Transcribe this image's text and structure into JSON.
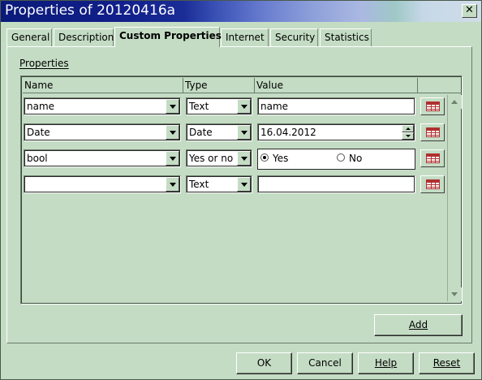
{
  "window": {
    "title": "Properties of 20120416a",
    "close_label": "✕"
  },
  "tabs": [
    {
      "label": "General"
    },
    {
      "label": "Description"
    },
    {
      "label": "Custom Properties",
      "active": true
    },
    {
      "label": "Internet"
    },
    {
      "label": "Security"
    },
    {
      "label": "Statistics"
    }
  ],
  "section": {
    "label": "Properties"
  },
  "columns": {
    "name": "Name",
    "type": "Type",
    "value": "Value"
  },
  "rows": [
    {
      "name": "name",
      "type": "Text",
      "value": "name"
    },
    {
      "name": "Date",
      "type": "Date",
      "value": "16.04.2012"
    },
    {
      "name": "bool",
      "type": "Yes or no",
      "radio_yes": "Yes",
      "radio_no": "No",
      "selected": "Yes"
    },
    {
      "name": "",
      "type": "Text",
      "value": ""
    }
  ],
  "buttons": {
    "add": "Add",
    "ok": "OK",
    "cancel": "Cancel",
    "help": "Help",
    "reset": "Reset"
  },
  "icons": {
    "close": "close-icon",
    "dropdown": "chevron-down-icon",
    "edit": "edit-table-icon",
    "spin": "spinner-icon"
  }
}
